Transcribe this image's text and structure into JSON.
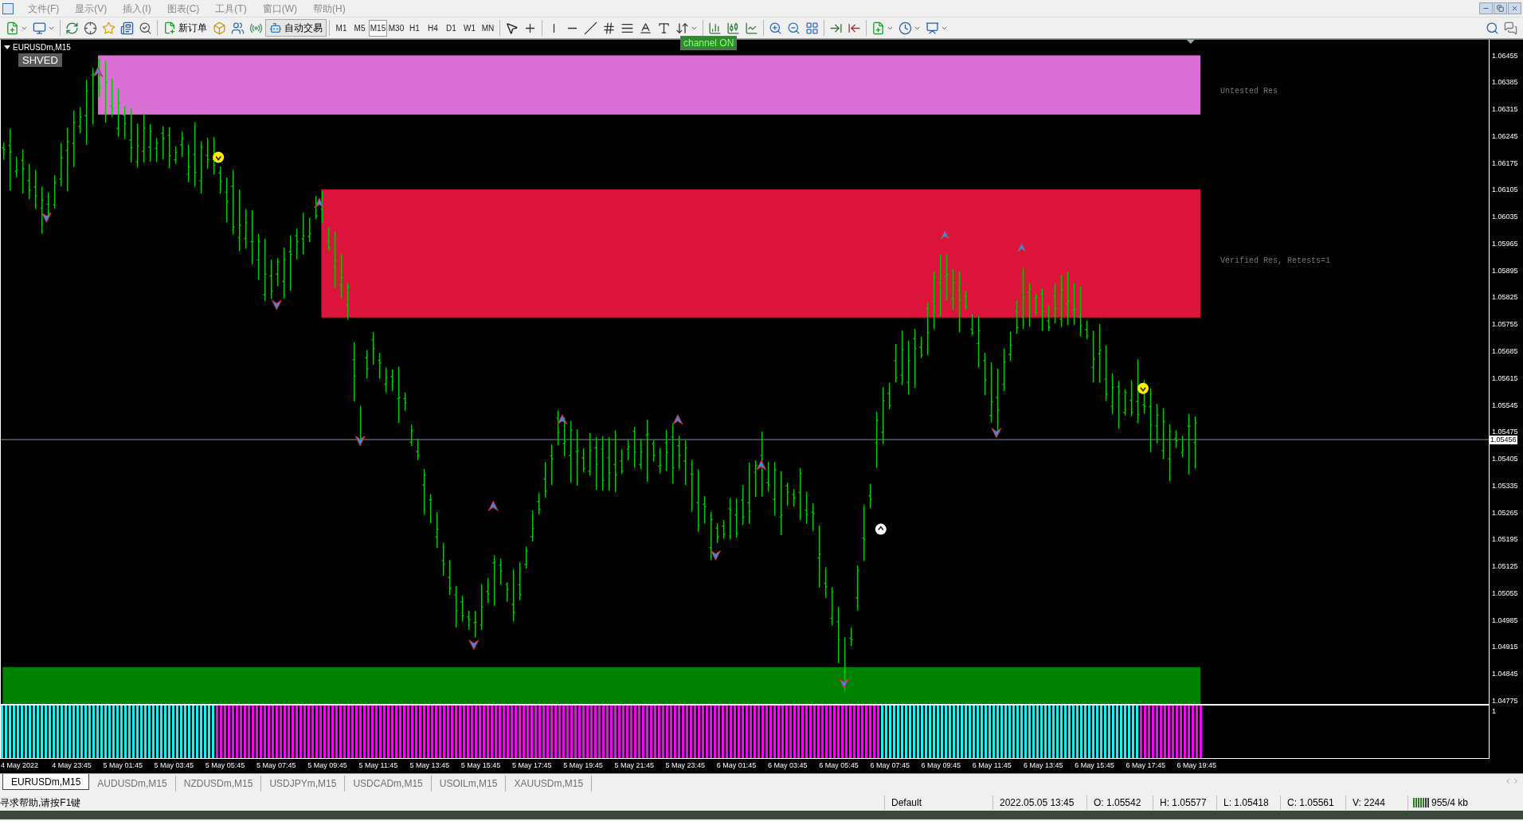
{
  "menu": [
    "文件(F)",
    "显示(V)",
    "插入(I)",
    "图表(C)",
    "工具(T)",
    "窗口(W)",
    "帮助(H)"
  ],
  "toolbar": {
    "new_order": "新订单",
    "auto_trading": "自动交易",
    "timeframes": [
      {
        "label": "M1",
        "selected": false
      },
      {
        "label": "M5",
        "selected": false
      },
      {
        "label": "M15",
        "selected": true
      },
      {
        "label": "M30",
        "selected": false
      },
      {
        "label": "H1",
        "selected": false
      },
      {
        "label": "H4",
        "selected": false
      },
      {
        "label": "D1",
        "selected": false
      },
      {
        "label": "W1",
        "selected": false
      },
      {
        "label": "MN",
        "selected": false
      }
    ]
  },
  "chart": {
    "title": "EURUSDm,M15",
    "indicator_tag": "SHVED",
    "channel_badge": "channel ON",
    "zones": [
      {
        "label": "Untested Res",
        "color": "#da70d6"
      },
      {
        "label": "Verified Res, Retests=1",
        "color": "#dc143c"
      },
      {
        "color": "#008000"
      }
    ],
    "price_ticks": [
      "1.06455",
      "1.06385",
      "1.06315",
      "1.06245",
      "1.06175",
      "1.06105",
      "1.06035",
      "1.05965",
      "1.05895",
      "1.05825",
      "1.05755",
      "1.05685",
      "1.05615",
      "1.05545",
      "1.05475",
      "1.05405",
      "1.05335",
      "1.05265",
      "1.05195",
      "1.05125",
      "1.05055",
      "1.04985",
      "1.04915",
      "1.04845",
      "1.04775"
    ],
    "current_price": "1.05456",
    "indicator_scale": "1",
    "indicator_segments": [
      {
        "color": "#00ffff"
      },
      {
        "color": "#ff00ff"
      },
      {
        "color": "#00ffff"
      },
      {
        "color": "#ff00ff"
      }
    ],
    "time_labels": [
      "4 May 2022",
      "4 May 23:45",
      "5 May 01:45",
      "5 May 03:45",
      "5 May 05:45",
      "5 May 07:45",
      "5 May 09:45",
      "5 May 11:45",
      "5 May 13:45",
      "5 May 15:45",
      "5 May 17:45",
      "5 May 19:45",
      "5 May 21:45",
      "5 May 23:45",
      "6 May 01:45",
      "6 May 03:45",
      "6 May 05:45",
      "6 May 07:45",
      "6 May 09:45",
      "6 May 11:45",
      "6 May 13:45",
      "6 May 15:45",
      "6 May 17:45",
      "6 May 19:45"
    ]
  },
  "tabs": [
    {
      "label": "EURUSDm,M15",
      "selected": true
    },
    {
      "label": "AUDUSDm,M15",
      "selected": false
    },
    {
      "label": "NZDUSDm,M15",
      "selected": false
    },
    {
      "label": "USDJPYm,M15",
      "selected": false
    },
    {
      "label": "USDCADm,M15",
      "selected": false
    },
    {
      "label": "USOILm,M15",
      "selected": false
    },
    {
      "label": "XAUUSDm,M15",
      "selected": false
    }
  ],
  "status_bar": {
    "help": "寻求帮助,请按F1键",
    "profile": "Default",
    "time": "2022.05.05 13:45",
    "open": "O: 1.05542",
    "high": "H: 1.05577",
    "low": "L: 1.05418",
    "close": "C: 1.05561",
    "volume": "V: 2244",
    "traffic": "955/4 kb"
  }
}
